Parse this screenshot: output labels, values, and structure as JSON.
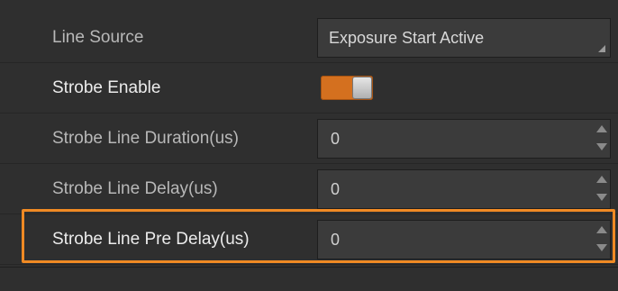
{
  "properties": [
    {
      "label": "Line Source",
      "type": "select",
      "value": "Exposure Start Active"
    },
    {
      "label": "Strobe Enable",
      "type": "toggle",
      "value": "on"
    },
    {
      "label": "Strobe Line Duration(us)",
      "type": "spinbox",
      "value": "0"
    },
    {
      "label": "Strobe Line Delay(us)",
      "type": "spinbox",
      "value": "0"
    },
    {
      "label": "Strobe Line Pre Delay(us)",
      "type": "spinbox",
      "value": "0"
    }
  ],
  "highlighted_row": "Strobe Line Pre Delay(us)",
  "colors": {
    "background": "#2f2f2f",
    "field": "#3b3b3b",
    "accent": "#d4701f",
    "highlight_border": "#f08a24"
  },
  "icons": {
    "select_corner": "dropdown-corner-icon",
    "spin_up": "spin-up-arrow-icon",
    "spin_down": "spin-down-arrow-icon"
  }
}
